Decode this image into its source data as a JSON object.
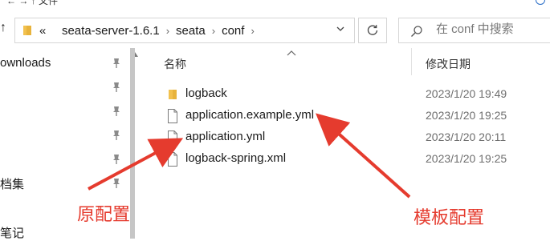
{
  "window": {
    "topstrip_cut_text": "← → ↑  文件"
  },
  "address": {
    "overflow": "«",
    "crumbs": [
      "seata-server-1.6.1",
      "seata",
      "conf"
    ],
    "separator": "›"
  },
  "search": {
    "placeholder": "在 conf 中搜索"
  },
  "nav": {
    "items": [
      {
        "label": "ownloads"
      },
      {
        "label": "档集"
      },
      {
        "label": "笔记"
      }
    ]
  },
  "columns": {
    "name": "名称",
    "date_modified": "修改日期"
  },
  "files": [
    {
      "name": "logback",
      "date": "2023/1/20 19:49",
      "icon": "folder-icon"
    },
    {
      "name": "application.example.yml",
      "date": "2023/1/20 19:25",
      "icon": "file-icon"
    },
    {
      "name": "application.yml",
      "date": "2023/1/20 20:11",
      "icon": "file-icon"
    },
    {
      "name": "logback-spring.xml",
      "date": "2023/1/20 19:25",
      "icon": "file-icon"
    }
  ],
  "annotations": {
    "original": "原配置",
    "template": "模板配置"
  },
  "colors": {
    "annotation": "#e53b2e",
    "folder": "#f2c14e",
    "accent": "#2a6ec8"
  }
}
